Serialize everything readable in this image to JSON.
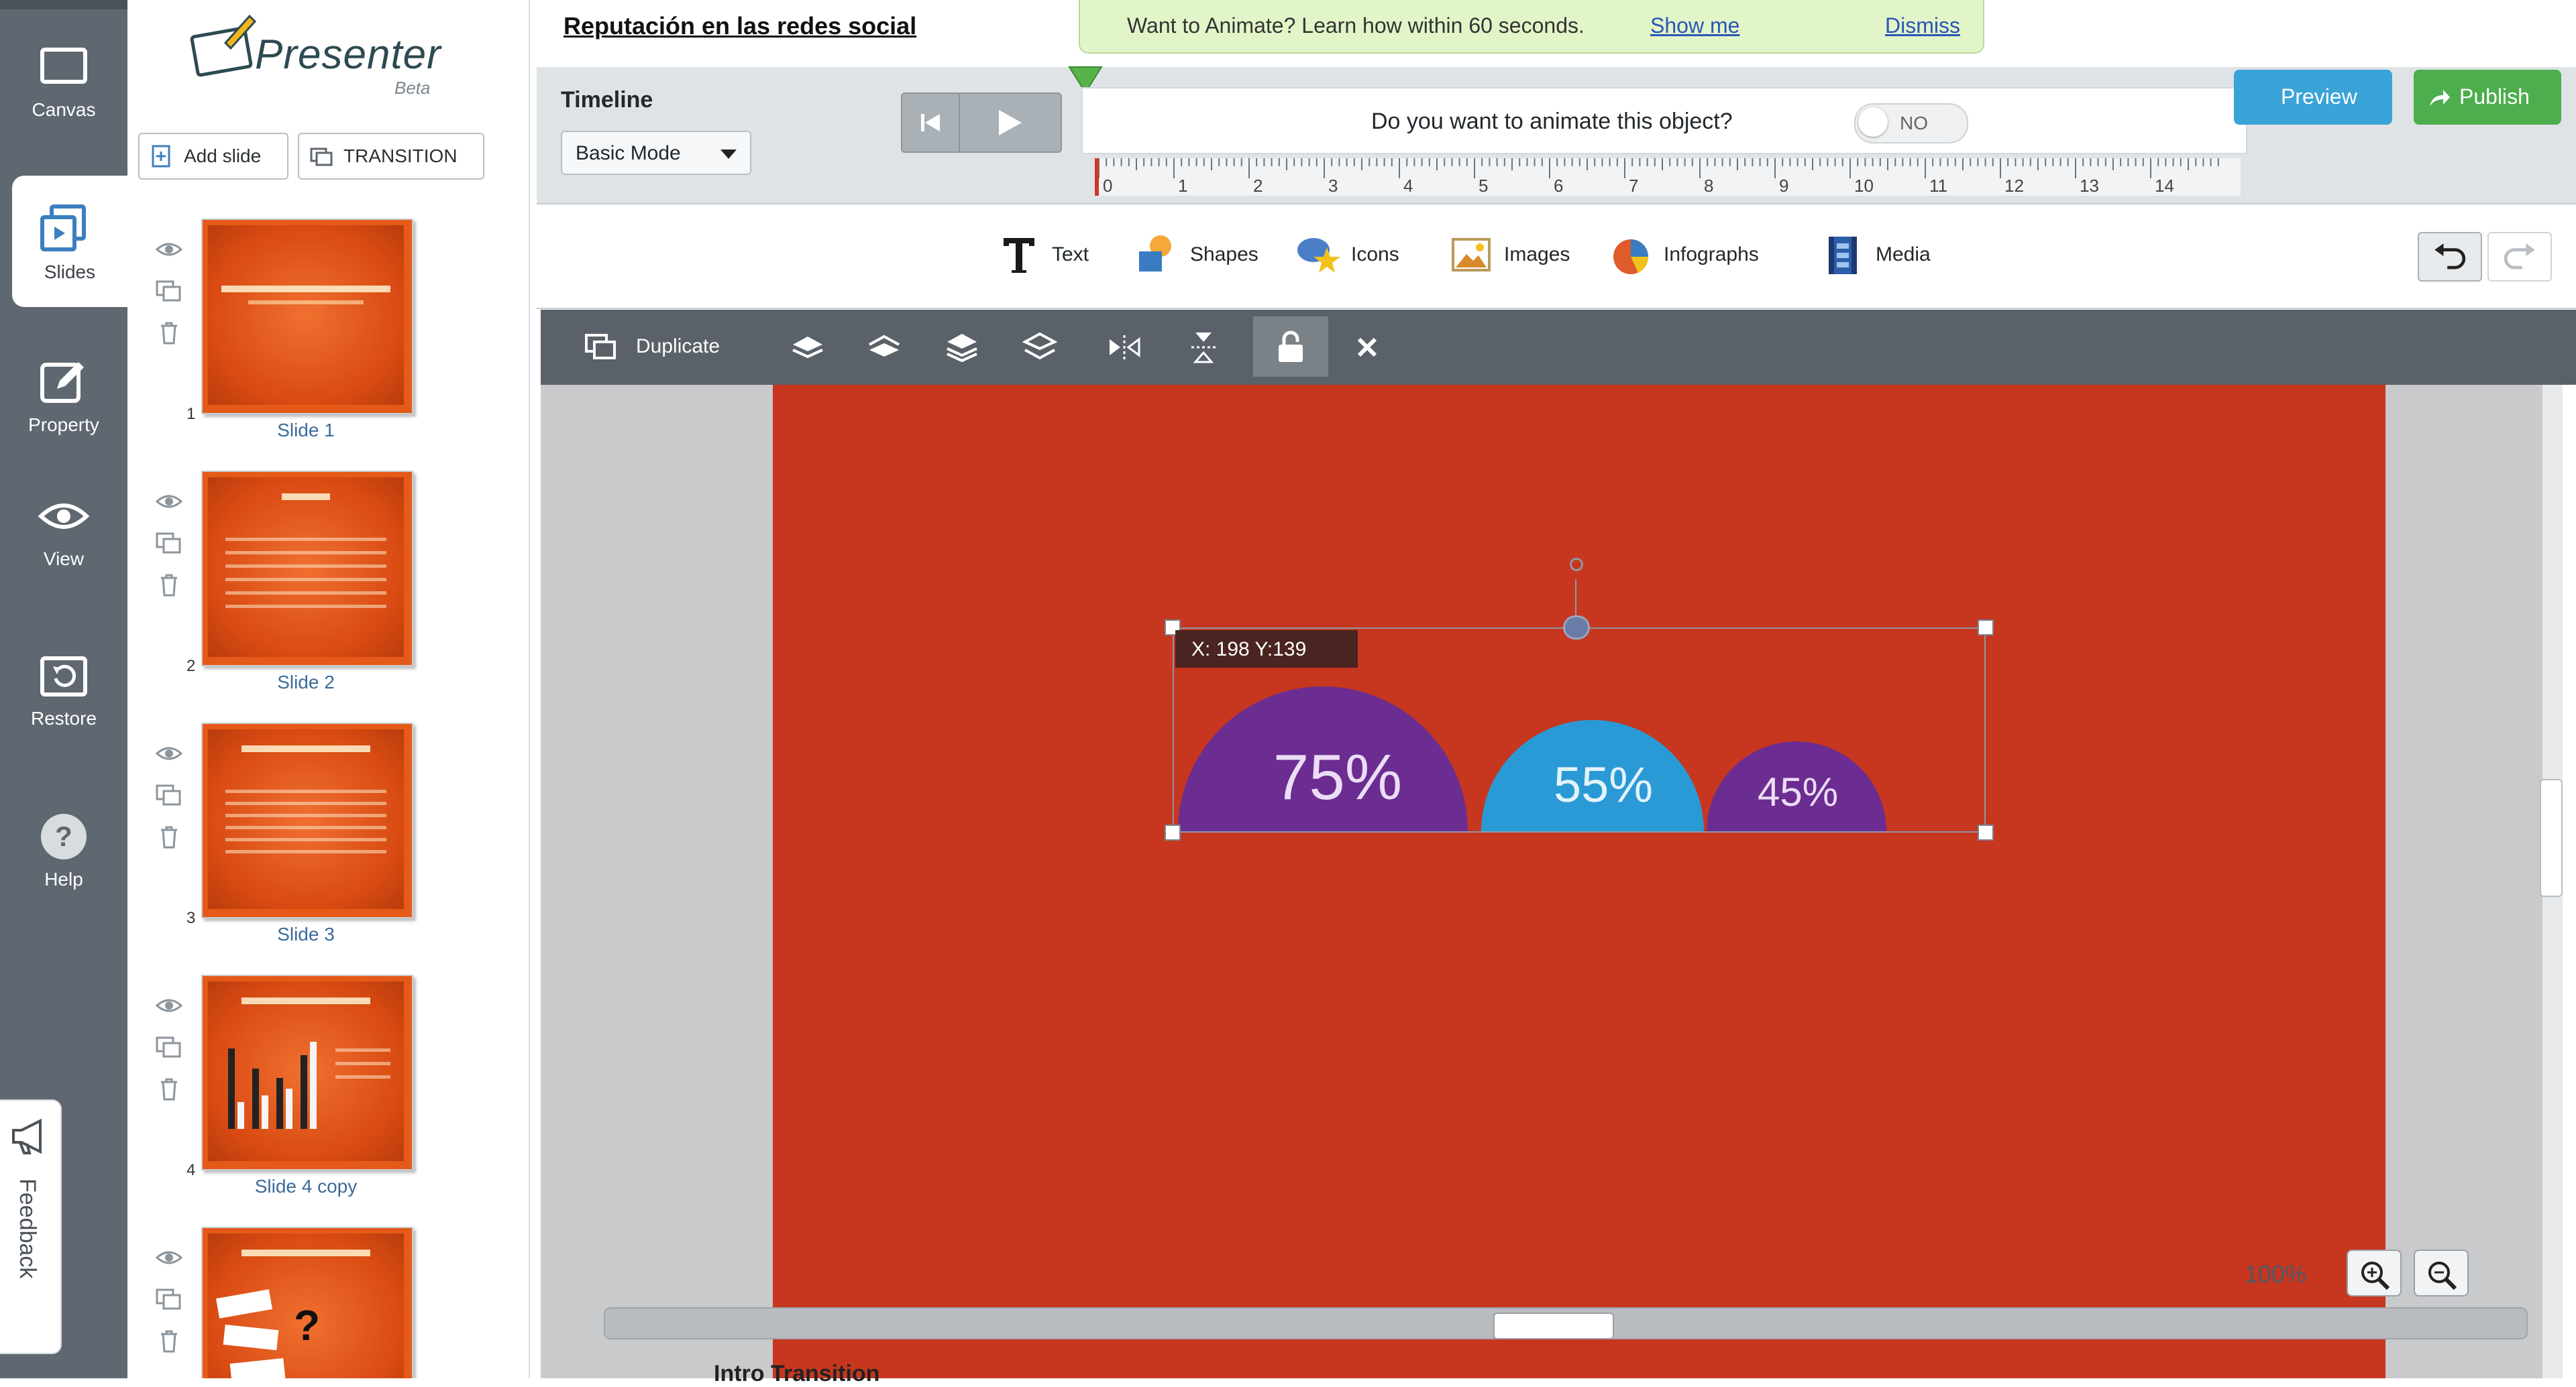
{
  "document_title": "Reputación en las redes social",
  "notification": {
    "message": "Want to Animate? Learn how within 60 seconds.",
    "show_link": "Show me",
    "dismiss": "Dismiss"
  },
  "nav": [
    {
      "label": "Canvas",
      "icon": "canvas-icon"
    },
    {
      "label": "Slides",
      "icon": "slides-icon"
    },
    {
      "label": "Property",
      "icon": "pencil-icon"
    },
    {
      "label": "View",
      "icon": "eye-icon"
    },
    {
      "label": "Restore",
      "icon": "restore-icon"
    },
    {
      "label": "Help",
      "icon": "help-icon"
    }
  ],
  "feedback": "Feedback",
  "logo": {
    "name": "Presenter",
    "edition": "Beta"
  },
  "slides_panel": {
    "add_slide": "Add slide",
    "transition": "TRANSITION",
    "slides": [
      {
        "number": "1",
        "caption": "Slide 1"
      },
      {
        "number": "2",
        "caption": "Slide 2"
      },
      {
        "number": "3",
        "caption": "Slide 3"
      },
      {
        "number": "4",
        "caption": "Slide 4 copy"
      },
      {
        "number": "",
        "caption": ""
      }
    ]
  },
  "timeline": {
    "label": "Timeline",
    "mode": "Basic Mode",
    "ruler_ticks": [
      "0",
      "1",
      "2",
      "3",
      "4",
      "5",
      "6",
      "7",
      "8",
      "9",
      "10",
      "11",
      "12",
      "13",
      "14"
    ]
  },
  "animate_popup": {
    "question": "Do you want to animate this object?",
    "toggle": "NO"
  },
  "actions": {
    "preview": "Preview",
    "publish": "Publish"
  },
  "insert_toolbar": [
    {
      "label": "Text",
      "icon": "text-icon"
    },
    {
      "label": "Shapes",
      "icon": "shapes-icon"
    },
    {
      "label": "Icons",
      "icon": "icons-icon"
    },
    {
      "label": "Images",
      "icon": "images-icon"
    },
    {
      "label": "Infographs",
      "icon": "infographs-icon"
    },
    {
      "label": "Media",
      "icon": "media-icon"
    }
  ],
  "object_toolbar": {
    "duplicate": "Duplicate",
    "icons": [
      "bring-front-icon",
      "bring-forward-icon",
      "send-backward-icon",
      "send-back-icon",
      "flip-horizontal-icon",
      "flip-vertical-icon",
      "lock-icon",
      "close-icon"
    ]
  },
  "canvas": {
    "coords": "X: 198 Y:139",
    "semicircles": [
      {
        "label": "75%",
        "color": "#6b2d91"
      },
      {
        "label": "55%",
        "color": "#2a9ad6"
      },
      {
        "label": "45%",
        "color": "#6b2d91"
      }
    ],
    "zoom": "100%"
  },
  "bottom_text": "Intro Transition",
  "colors": {
    "accent_blue": "#3aa3d8",
    "publish_green": "#4cae4c",
    "slide_bg": "#c7361f",
    "thumb_orange": "#e55a18"
  }
}
